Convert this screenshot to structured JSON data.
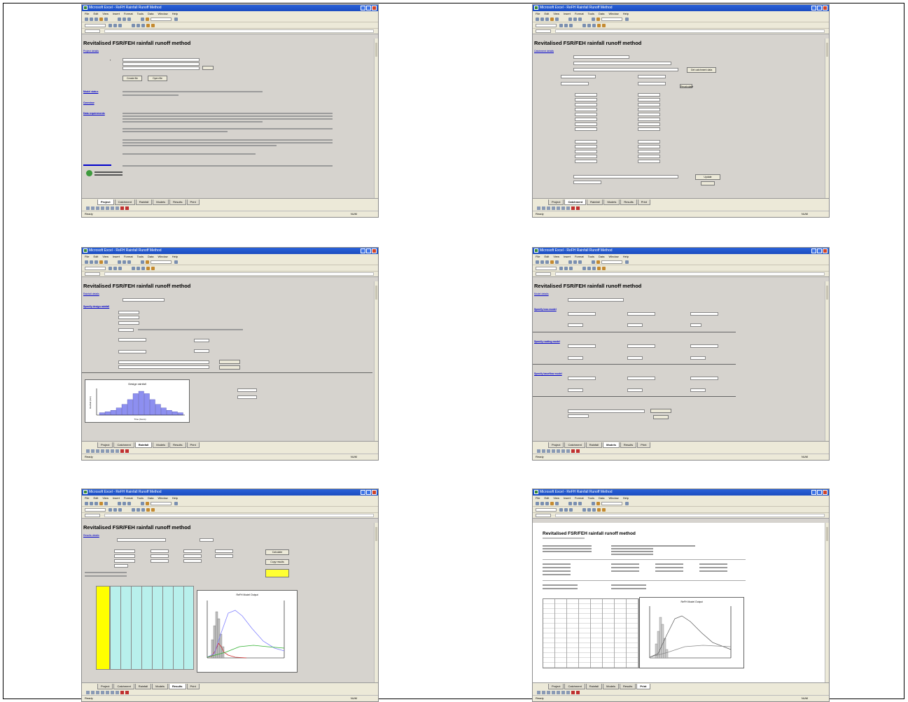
{
  "window": {
    "title": "Microsoft Excel - ReFH Rainfall Runoff Method",
    "menu": [
      "File",
      "Edit",
      "View",
      "Insert",
      "Format",
      "Tools",
      "Data",
      "Window",
      "Help"
    ]
  },
  "app": {
    "heading": "Revitalised FSR/FEH rainfall runoff method",
    "tabs": [
      "Project",
      "Catchment",
      "Rainfall",
      "Models",
      "Results",
      "Print"
    ]
  },
  "screens": [
    {
      "id": "project",
      "active_tab": "Project",
      "link": "Project details",
      "buttons": [
        "Create file",
        "Open file"
      ],
      "sections": [
        "Model status",
        "Overview",
        "Data requirements"
      ]
    },
    {
      "id": "catchment",
      "active_tab": "Catchment",
      "link": "Catchment details",
      "buttons": [
        "Get catchment data",
        "Recalculate",
        "Update"
      ]
    },
    {
      "id": "rainfall",
      "active_tab": "Rainfall",
      "link": "Rainfall details",
      "section": "Specify design rainfall",
      "chart_title": "Design rainfall",
      "chart_xlabel": "Time (hours)",
      "chart_ylabel": "Rainfall (mm)"
    },
    {
      "id": "models",
      "active_tab": "Models",
      "link": "Model details",
      "sections": [
        "Specify loss model",
        "Specify routing model",
        "Specify baseflow model"
      ]
    },
    {
      "id": "results",
      "active_tab": "Results",
      "link": "Results details",
      "buttons": [
        "Calculate",
        "Copy results"
      ],
      "chart_title": "ReFH Model Output"
    },
    {
      "id": "print",
      "active_tab": "Print",
      "heading": "Revitalised FSR/FEH rainfall runoff method",
      "chart_title": "ReFH Model Output"
    }
  ],
  "status": {
    "ready": "Ready",
    "num": "NUM"
  },
  "colors": {
    "sheet_grey": "#d6d3ce",
    "title_blue": "#2a62d8",
    "histogram": "#8d8ff0",
    "peak_line": "#8080ff",
    "total_line": "#30b030",
    "yellow": "#ffff00",
    "cyan": "#b8f0ec"
  }
}
